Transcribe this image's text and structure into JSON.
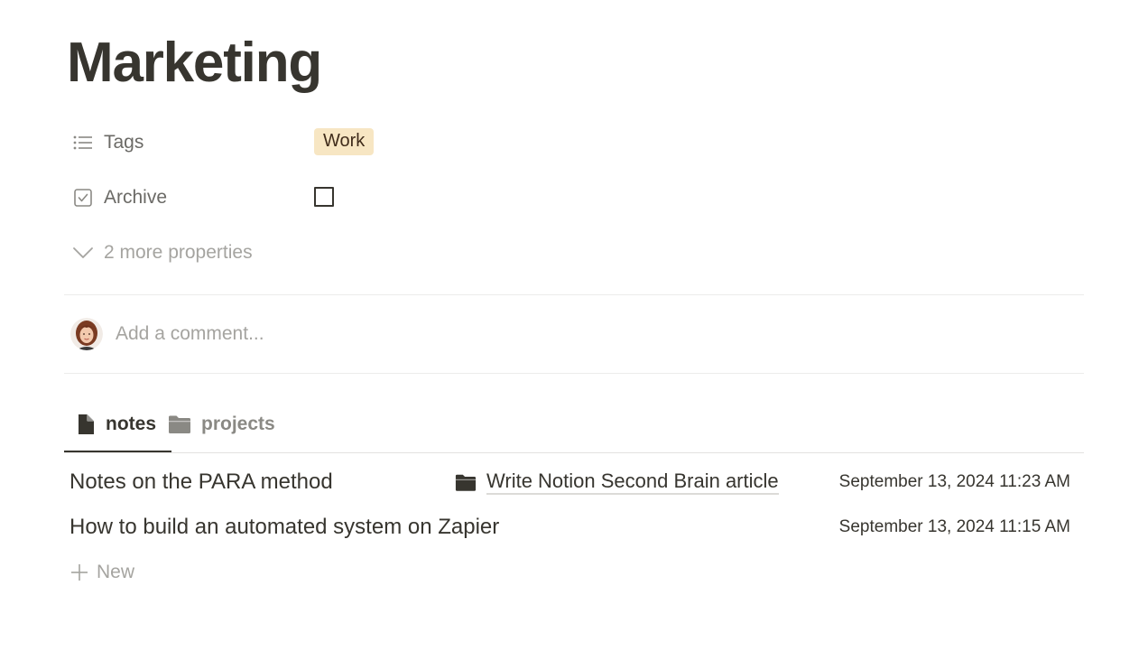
{
  "page": {
    "title": "Marketing"
  },
  "properties": [
    {
      "icon": "list-icon",
      "label": "Tags",
      "value": "Work"
    },
    {
      "icon": "checkbox-property-icon",
      "label": "Archive",
      "checked": false
    }
  ],
  "more_properties_label": "2 more properties",
  "comment": {
    "placeholder": "Add a comment..."
  },
  "tabs": [
    {
      "icon": "document-icon",
      "label": "notes",
      "active": true
    },
    {
      "icon": "folder-icon",
      "label": "projects",
      "active": false
    }
  ],
  "rows": [
    {
      "title": "Notes on the PARA method",
      "relation_icon": "folder-icon",
      "relation": "Write Notion Second Brain article",
      "date": "September 13, 2024 11:23 AM"
    },
    {
      "title": "How to build an automated system on Zapier",
      "relation": "",
      "date": "September 13, 2024 11:15 AM"
    }
  ],
  "new_label": "New",
  "colors": {
    "text": "#37352f",
    "muted": "#a5a4a0",
    "tag_bg": "#f7e6c3",
    "divider": "#ececeb"
  }
}
